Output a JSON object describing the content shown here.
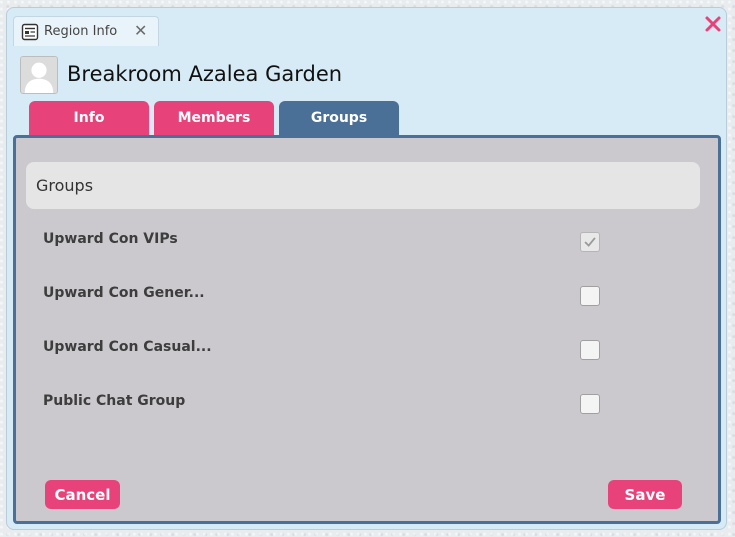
{
  "window": {
    "tab_label": "Region Info",
    "title": "Breakroom Azalea Garden"
  },
  "tabs": [
    {
      "label": "Info",
      "active": false
    },
    {
      "label": "Members",
      "active": false
    },
    {
      "label": "Groups",
      "active": true
    }
  ],
  "groups": {
    "header": "Groups",
    "items": [
      {
        "name": "Upward Con VIPs",
        "checked": true
      },
      {
        "name": "Upward Con Gener...",
        "checked": false
      },
      {
        "name": "Upward Con Casual...",
        "checked": false
      },
      {
        "name": "Public Chat Group",
        "checked": false
      }
    ]
  },
  "actions": {
    "cancel_label": "Cancel",
    "save_label": "Save"
  },
  "icons": {
    "tab": "region-info-icon",
    "tab_close": "close-icon",
    "window_close": "close-icon",
    "avatar": "user-avatar-icon",
    "check": "checkmark-icon"
  },
  "colors": {
    "accent_pink": "#e8427a",
    "active_tab_blue": "#4a7098",
    "window_bg": "#d7ebf6",
    "panel_bg": "#cbc9ce"
  }
}
